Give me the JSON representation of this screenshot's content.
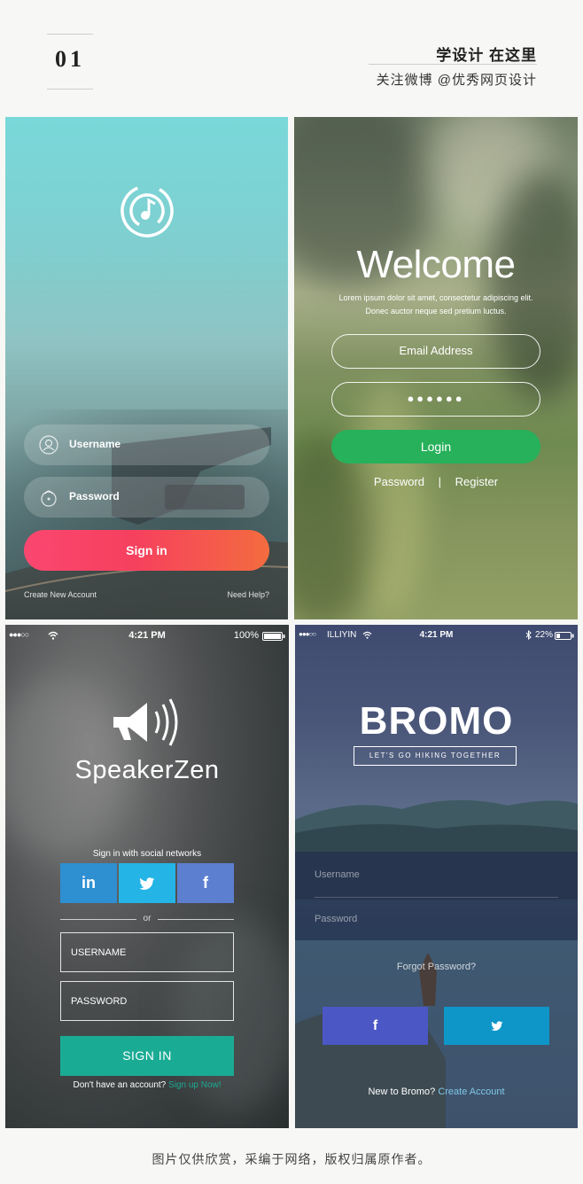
{
  "header": {
    "number": "01",
    "title": "学设计 在这里",
    "subtitle": "关注微博 @优秀网页设计"
  },
  "footer": {
    "caption": "图片仅供欣赏，采编于网络，版权归属原作者。"
  },
  "panel1": {
    "logo_icon": "music-note-icon",
    "username_placeholder": "Username",
    "password_placeholder": "Password",
    "username_icon": "user-icon",
    "password_icon": "lock-icon",
    "signin_label": "Sign in",
    "create_account": "Create New Account",
    "need_help": "Need Help?",
    "colors": {
      "gradient_start": "#fb4770",
      "gradient_end": "#f46c3f",
      "bg": "#79d8d9"
    }
  },
  "panel2": {
    "title": "Welcome",
    "lorem_line1": "Lorem ipsum dolor sit amet, consectetur adipiscing elit.",
    "lorem_line2": "Donec auctor neque sed pretium luctus.",
    "email_placeholder": "Email Address",
    "password_value": "●●●●●●",
    "login_label": "Login",
    "password_link": "Password",
    "divider": "|",
    "register_link": "Register",
    "colors": {
      "login": "#27b15b"
    }
  },
  "panel3": {
    "status": {
      "signal": "●●●○○",
      "wifi_icon": "wifi-icon",
      "time": "4:21 PM",
      "battery": "100%",
      "battery_icon": "battery-icon"
    },
    "logo_icon": "megaphone-icon",
    "brand": "SpeakerZen",
    "social_caption": "Sign in with social networks",
    "linkedin_label": "in",
    "twitter_icon": "twitter-icon",
    "facebook_label": "f",
    "or_label": "or",
    "username_placeholder": "USERNAME",
    "password_placeholder": "PASSWORD",
    "signin_label": "SIGN IN",
    "no_account": "Don't have an account?",
    "signup_link": "Sign up Now!",
    "colors": {
      "linkedin": "#2e8fd1",
      "twitter": "#24b4e6",
      "facebook": "#5d7fd0",
      "signin": "#1aab94"
    }
  },
  "panel4": {
    "status": {
      "signal": "●●●○○",
      "carrier": "ILLIYIN",
      "wifi_icon": "wifi-icon",
      "time": "4:21 PM",
      "bluetooth_icon": "bluetooth-icon",
      "battery": "22%",
      "battery_icon": "battery-icon"
    },
    "logo": "BROMO",
    "tagline": "LET'S GO HIKING TOGETHER",
    "username_placeholder": "Username",
    "password_placeholder": "Password",
    "forgot": "Forgot Password?",
    "facebook_label": "f",
    "twitter_icon": "twitter-icon",
    "new_text": "New to Bromo?",
    "create_account": "Create Account",
    "colors": {
      "facebook": "#4b57c4",
      "twitter": "#0e96c8"
    }
  }
}
